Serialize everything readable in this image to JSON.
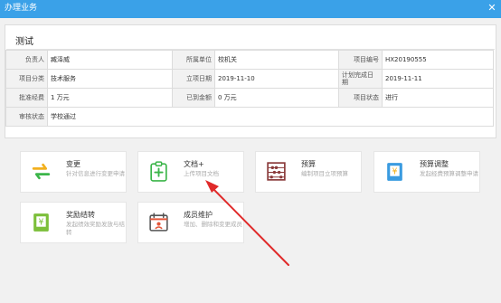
{
  "window": {
    "title": "办理业务",
    "close_glyph": "✕"
  },
  "project": {
    "name": "测试",
    "rows": [
      [
        {
          "label": "负责人"
        },
        {
          "value": "臧泽威"
        },
        {
          "label": "所属单位"
        },
        {
          "value": "校机关"
        },
        {
          "label": "项目编号"
        },
        {
          "value": "HX20190555"
        }
      ],
      [
        {
          "label": "项目分类"
        },
        {
          "value": "技术服务"
        },
        {
          "label": "立项日期"
        },
        {
          "value": "2019-11-10"
        },
        {
          "label": "计划完成日期"
        },
        {
          "value": "2019-11-11"
        }
      ],
      [
        {
          "label": "批准经费"
        },
        {
          "value": "1 万元"
        },
        {
          "label": "已到金额"
        },
        {
          "value": "0 万元"
        },
        {
          "label": "项目状态"
        },
        {
          "value": "进行"
        }
      ]
    ],
    "audit": {
      "label": "审核状态",
      "value": "学校通过"
    }
  },
  "actions": [
    {
      "key": "change",
      "name": "变更",
      "desc": "针对信息进行变更申请",
      "icon": "exchange-arrows-icon",
      "color": "#3cb54a"
    },
    {
      "key": "docs",
      "name": "文档+",
      "desc": "上传项目文档",
      "icon": "document-upload-icon",
      "color": "#3cb54a"
    },
    {
      "key": "budget",
      "name": "预算",
      "desc": "编制项目立项预算",
      "icon": "abacus-icon",
      "color": "#9a3a3a"
    },
    {
      "key": "budget-adjust",
      "name": "预算调整",
      "desc": "发起经费预算调整申请",
      "icon": "budget-adjust-icon",
      "color": "#3a9be0"
    },
    {
      "key": "reward",
      "name": "奖励结转",
      "desc": "发起绩效奖励发放与结转",
      "icon": "reward-transfer-icon",
      "color": "#7cbf3a"
    },
    {
      "key": "members",
      "name": "成员维护",
      "desc": "增加、删除和变更成员",
      "icon": "member-calendar-icon",
      "color": "#e4573b"
    }
  ],
  "annotation": {
    "color": "#e02a2a"
  }
}
